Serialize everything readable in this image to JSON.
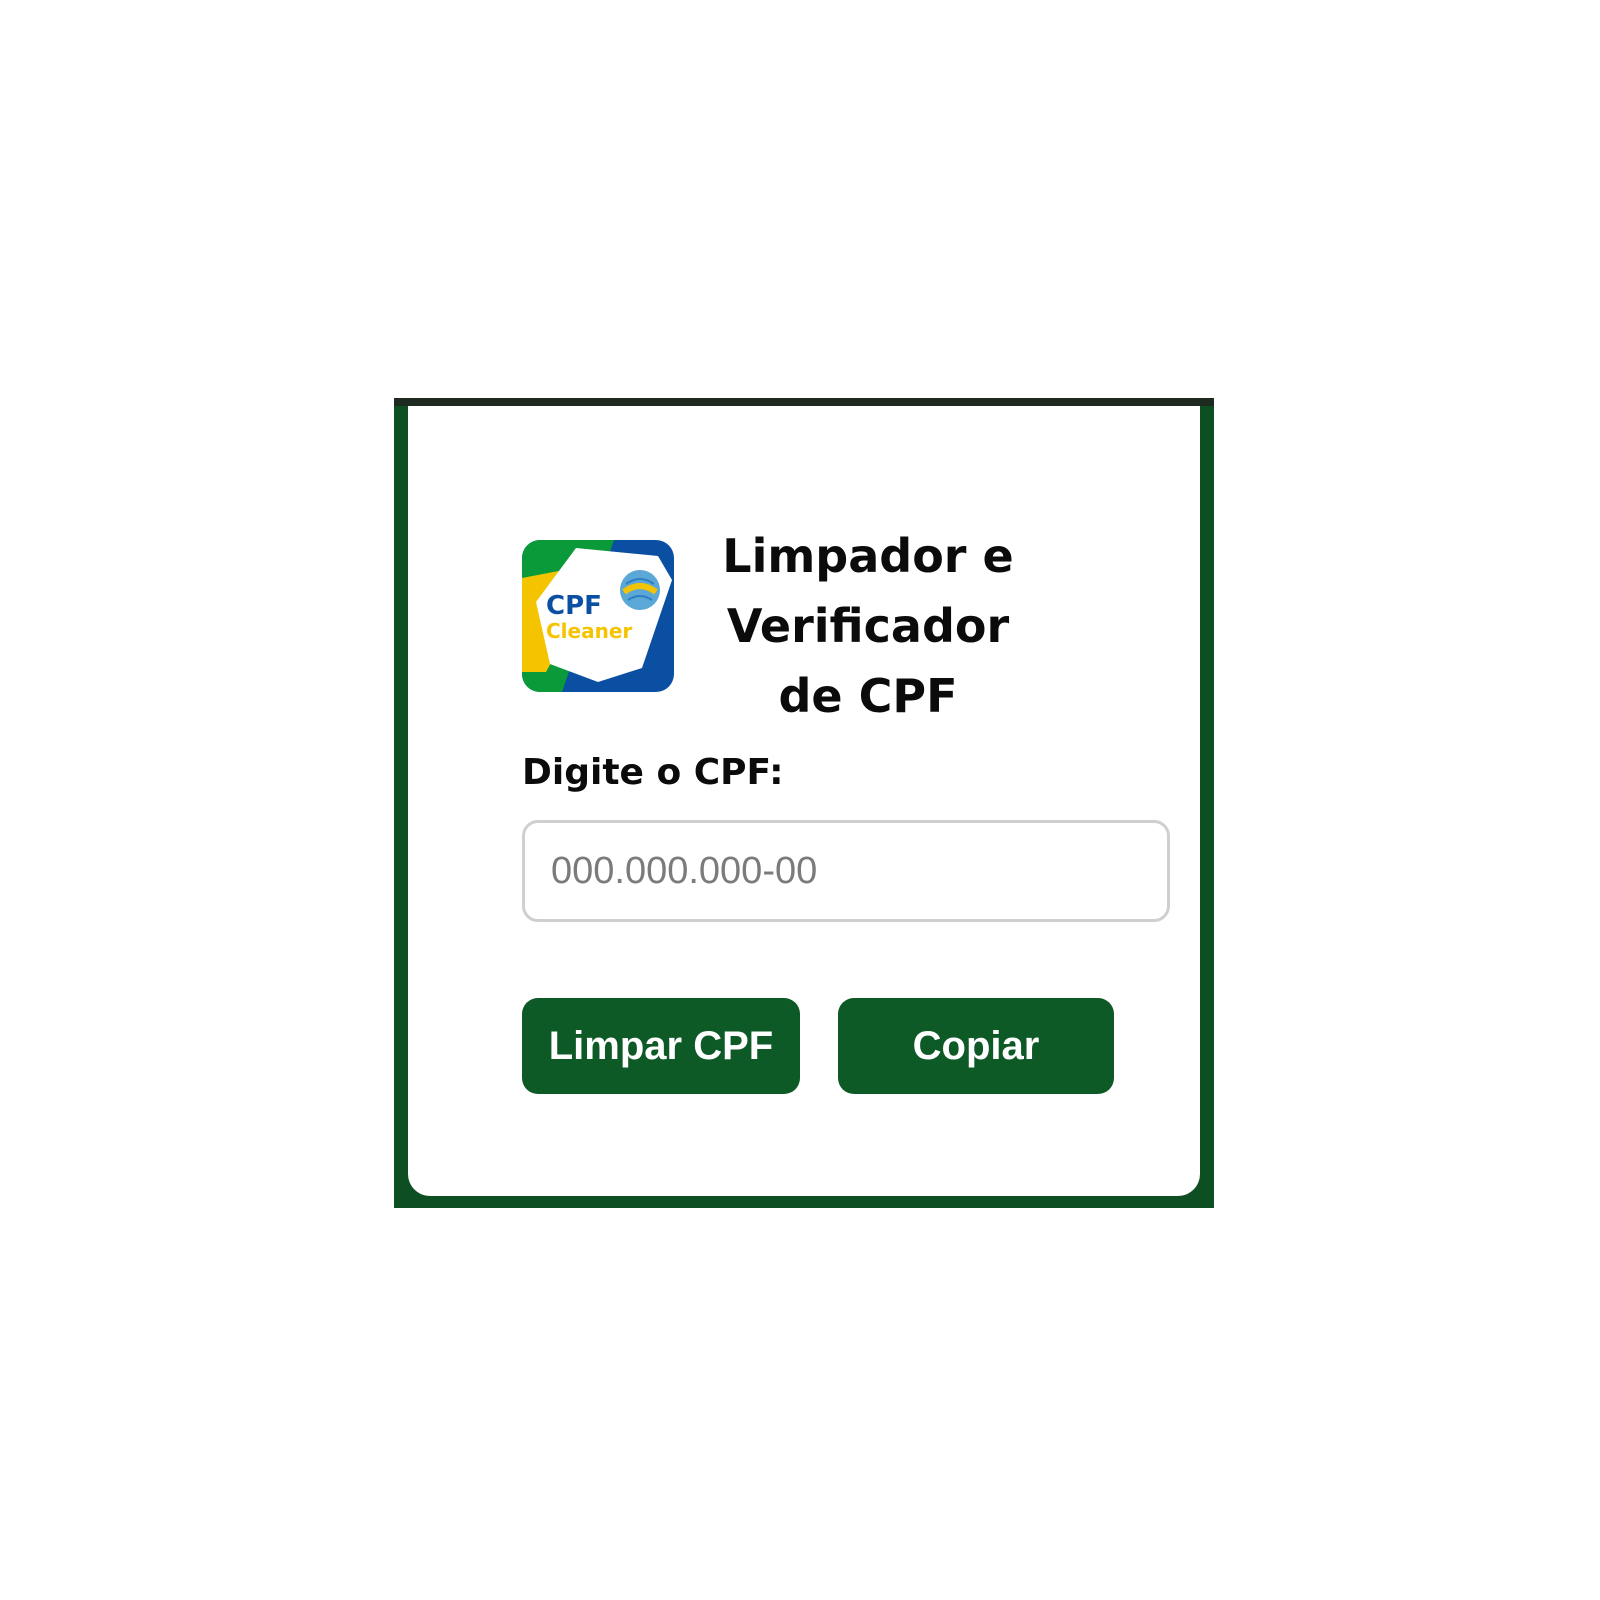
{
  "header": {
    "logo": {
      "text_line1": "CPF",
      "text_line2": "Cleaner",
      "colors": {
        "green": "#0a9a3a",
        "yellow": "#f5c400",
        "blue": "#0b4fa3"
      }
    },
    "title_lines": [
      "Limpador e",
      "Verificador",
      "de CPF"
    ]
  },
  "form": {
    "label": "Digite o CPF:",
    "input_value": "",
    "input_placeholder": "000.000.000-00"
  },
  "actions": {
    "clean_label": "Limpar CPF",
    "copy_label": "Copiar"
  },
  "theme": {
    "frame": "#0d4f22",
    "button": "#0d5a27"
  }
}
